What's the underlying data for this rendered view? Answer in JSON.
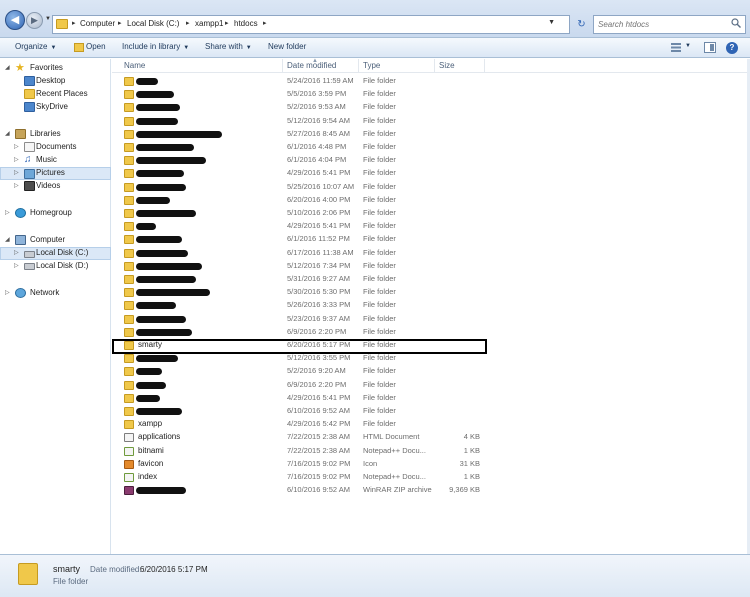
{
  "address": {
    "crumbs": [
      "Computer",
      "Local Disk (C:)",
      "xampp1",
      "htdocs"
    ],
    "search_placeholder": "Search htdocs"
  },
  "toolbar": {
    "organize": "Organize",
    "open": "Open",
    "include_in_library": "Include in library",
    "share_with": "Share with",
    "new_folder": "New folder"
  },
  "nav": {
    "favorites": "Favorites",
    "desktop": "Desktop",
    "recent_places": "Recent Places",
    "skydrive": "SkyDrive",
    "libraries": "Libraries",
    "documents": "Documents",
    "music": "Music",
    "pictures": "Pictures",
    "videos": "Videos",
    "homegroup": "Homegroup",
    "computer": "Computer",
    "local_disk_c": "Local Disk (C:)",
    "local_disk_d": "Local Disk (D:)",
    "network": "Network"
  },
  "columns": {
    "name": "Name",
    "date_modified": "Date modified",
    "type": "Type",
    "size": "Size"
  },
  "files": [
    {
      "name": "",
      "date": "5/24/2016 11:59 AM",
      "type": "File folder",
      "size": "",
      "icon": "folder-icon",
      "redacted": true
    },
    {
      "name": "",
      "date": "5/5/2016 3:59 PM",
      "type": "File folder",
      "size": "",
      "icon": "folder-icon",
      "redacted": true
    },
    {
      "name": "",
      "date": "5/2/2016 9:53 AM",
      "type": "File folder",
      "size": "",
      "icon": "folder-icon",
      "redacted": true
    },
    {
      "name": "",
      "date": "5/12/2016 9:54 AM",
      "type": "File folder",
      "size": "",
      "icon": "folder-icon",
      "redacted": true
    },
    {
      "name": "",
      "date": "5/27/2016 8:45 AM",
      "type": "File folder",
      "size": "",
      "icon": "folder-icon",
      "redacted": true
    },
    {
      "name": "",
      "date": "6/1/2016 4:48 PM",
      "type": "File folder",
      "size": "",
      "icon": "folder-icon",
      "redacted": true
    },
    {
      "name": "",
      "date": "6/1/2016 4:04 PM",
      "type": "File folder",
      "size": "",
      "icon": "folder-icon",
      "redacted": true
    },
    {
      "name": "",
      "date": "4/29/2016 5:41 PM",
      "type": "File folder",
      "size": "",
      "icon": "folder-icon",
      "redacted": true
    },
    {
      "name": "",
      "date": "5/25/2016 10:07 AM",
      "type": "File folder",
      "size": "",
      "icon": "folder-icon",
      "redacted": true
    },
    {
      "name": "",
      "date": "6/20/2016 4:00 PM",
      "type": "File folder",
      "size": "",
      "icon": "folder-icon",
      "redacted": true
    },
    {
      "name": "",
      "date": "5/10/2016 2:06 PM",
      "type": "File folder",
      "size": "",
      "icon": "folder-icon",
      "redacted": true
    },
    {
      "name": "",
      "date": "4/29/2016 5:41 PM",
      "type": "File folder",
      "size": "",
      "icon": "folder-icon",
      "redacted": true
    },
    {
      "name": "",
      "date": "6/1/2016 11:52 PM",
      "type": "File folder",
      "size": "",
      "icon": "folder-icon",
      "redacted": true
    },
    {
      "name": "",
      "date": "6/17/2016 11:38 AM",
      "type": "File folder",
      "size": "",
      "icon": "folder-icon",
      "redacted": true
    },
    {
      "name": "",
      "date": "5/12/2016 7:34 PM",
      "type": "File folder",
      "size": "",
      "icon": "folder-icon",
      "redacted": true
    },
    {
      "name": "",
      "date": "5/31/2016 9:27 AM",
      "type": "File folder",
      "size": "",
      "icon": "folder-icon",
      "redacted": true
    },
    {
      "name": "",
      "date": "5/30/2016 5:30 PM",
      "type": "File folder",
      "size": "",
      "icon": "folder-icon",
      "redacted": true
    },
    {
      "name": "",
      "date": "5/26/2016 3:33 PM",
      "type": "File folder",
      "size": "",
      "icon": "folder-icon",
      "redacted": true
    },
    {
      "name": "",
      "date": "5/23/2016 9:37 AM",
      "type": "File folder",
      "size": "",
      "icon": "folder-icon",
      "redacted": true
    },
    {
      "name": "",
      "date": "6/9/2016 2:20 PM",
      "type": "File folder",
      "size": "",
      "icon": "folder-icon",
      "redacted": true
    },
    {
      "name": "smarty",
      "date": "6/20/2016 5:17 PM",
      "type": "File folder",
      "size": "",
      "icon": "folder-icon",
      "redacted": false,
      "highlighted": true
    },
    {
      "name": "",
      "date": "5/12/2016 3:55 PM",
      "type": "File folder",
      "size": "",
      "icon": "folder-icon",
      "redacted": true
    },
    {
      "name": "",
      "date": "5/2/2016 9:20 AM",
      "type": "File folder",
      "size": "",
      "icon": "folder-icon",
      "redacted": true
    },
    {
      "name": "",
      "date": "6/9/2016 2:20 PM",
      "type": "File folder",
      "size": "",
      "icon": "folder-icon",
      "redacted": true
    },
    {
      "name": "",
      "date": "4/29/2016 5:41 PM",
      "type": "File folder",
      "size": "",
      "icon": "folder-icon",
      "redacted": true
    },
    {
      "name": "",
      "date": "6/10/2016 9:52 AM",
      "type": "File folder",
      "size": "",
      "icon": "folder-icon",
      "redacted": true
    },
    {
      "name": "xampp",
      "date": "4/29/2016 5:42 PM",
      "type": "File folder",
      "size": "",
      "icon": "folder-icon",
      "redacted": false
    },
    {
      "name": "applications",
      "date": "7/22/2015 2:38 AM",
      "type": "HTML Document",
      "size": "4 KB",
      "icon": "html-file-icon",
      "redacted": false
    },
    {
      "name": "bitnami",
      "date": "7/22/2015 2:38 AM",
      "type": "Notepad++ Docu...",
      "size": "1 KB",
      "icon": "notepad-file-icon",
      "redacted": false
    },
    {
      "name": "favicon",
      "date": "7/16/2015 9:02 PM",
      "type": "Icon",
      "size": "31 KB",
      "icon": "ico-file-icon",
      "redacted": false
    },
    {
      "name": "index",
      "date": "7/16/2015 9:02 PM",
      "type": "Notepad++ Docu...",
      "size": "1 KB",
      "icon": "notepad-file-icon",
      "redacted": false
    },
    {
      "name": "",
      "date": "6/10/2016 9:52 AM",
      "type": "WinRAR ZIP archive",
      "size": "9,369 KB",
      "icon": "zip-file-icon",
      "redacted": true
    }
  ],
  "details": {
    "name": "smarty",
    "date_label": "Date modified:",
    "date_value": "6/20/2016 5:17 PM",
    "type": "File folder"
  }
}
